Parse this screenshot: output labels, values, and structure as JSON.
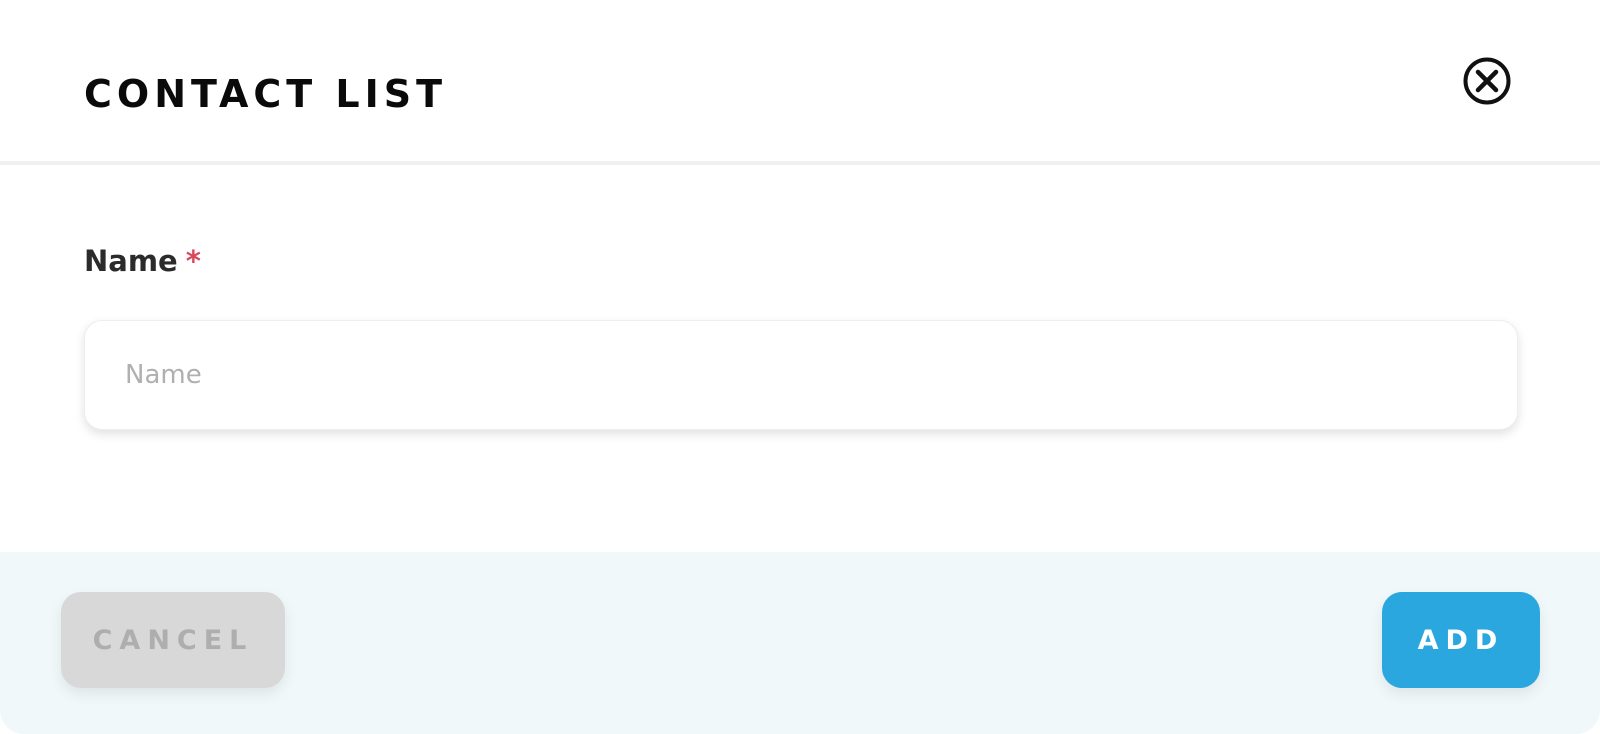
{
  "dialog": {
    "title": "CONTACT LIST",
    "close_icon": "close-circle-icon"
  },
  "form": {
    "name_field": {
      "label": "Name",
      "required_marker": "*",
      "placeholder": "Name",
      "value": ""
    }
  },
  "footer": {
    "cancel_label": "CANCEL",
    "add_label": "ADD"
  },
  "colors": {
    "accent": "#2aa7de",
    "required": "#d64a5c",
    "cancel_bg": "#d8d8d8",
    "footer_bg": "#f1f8fa"
  }
}
